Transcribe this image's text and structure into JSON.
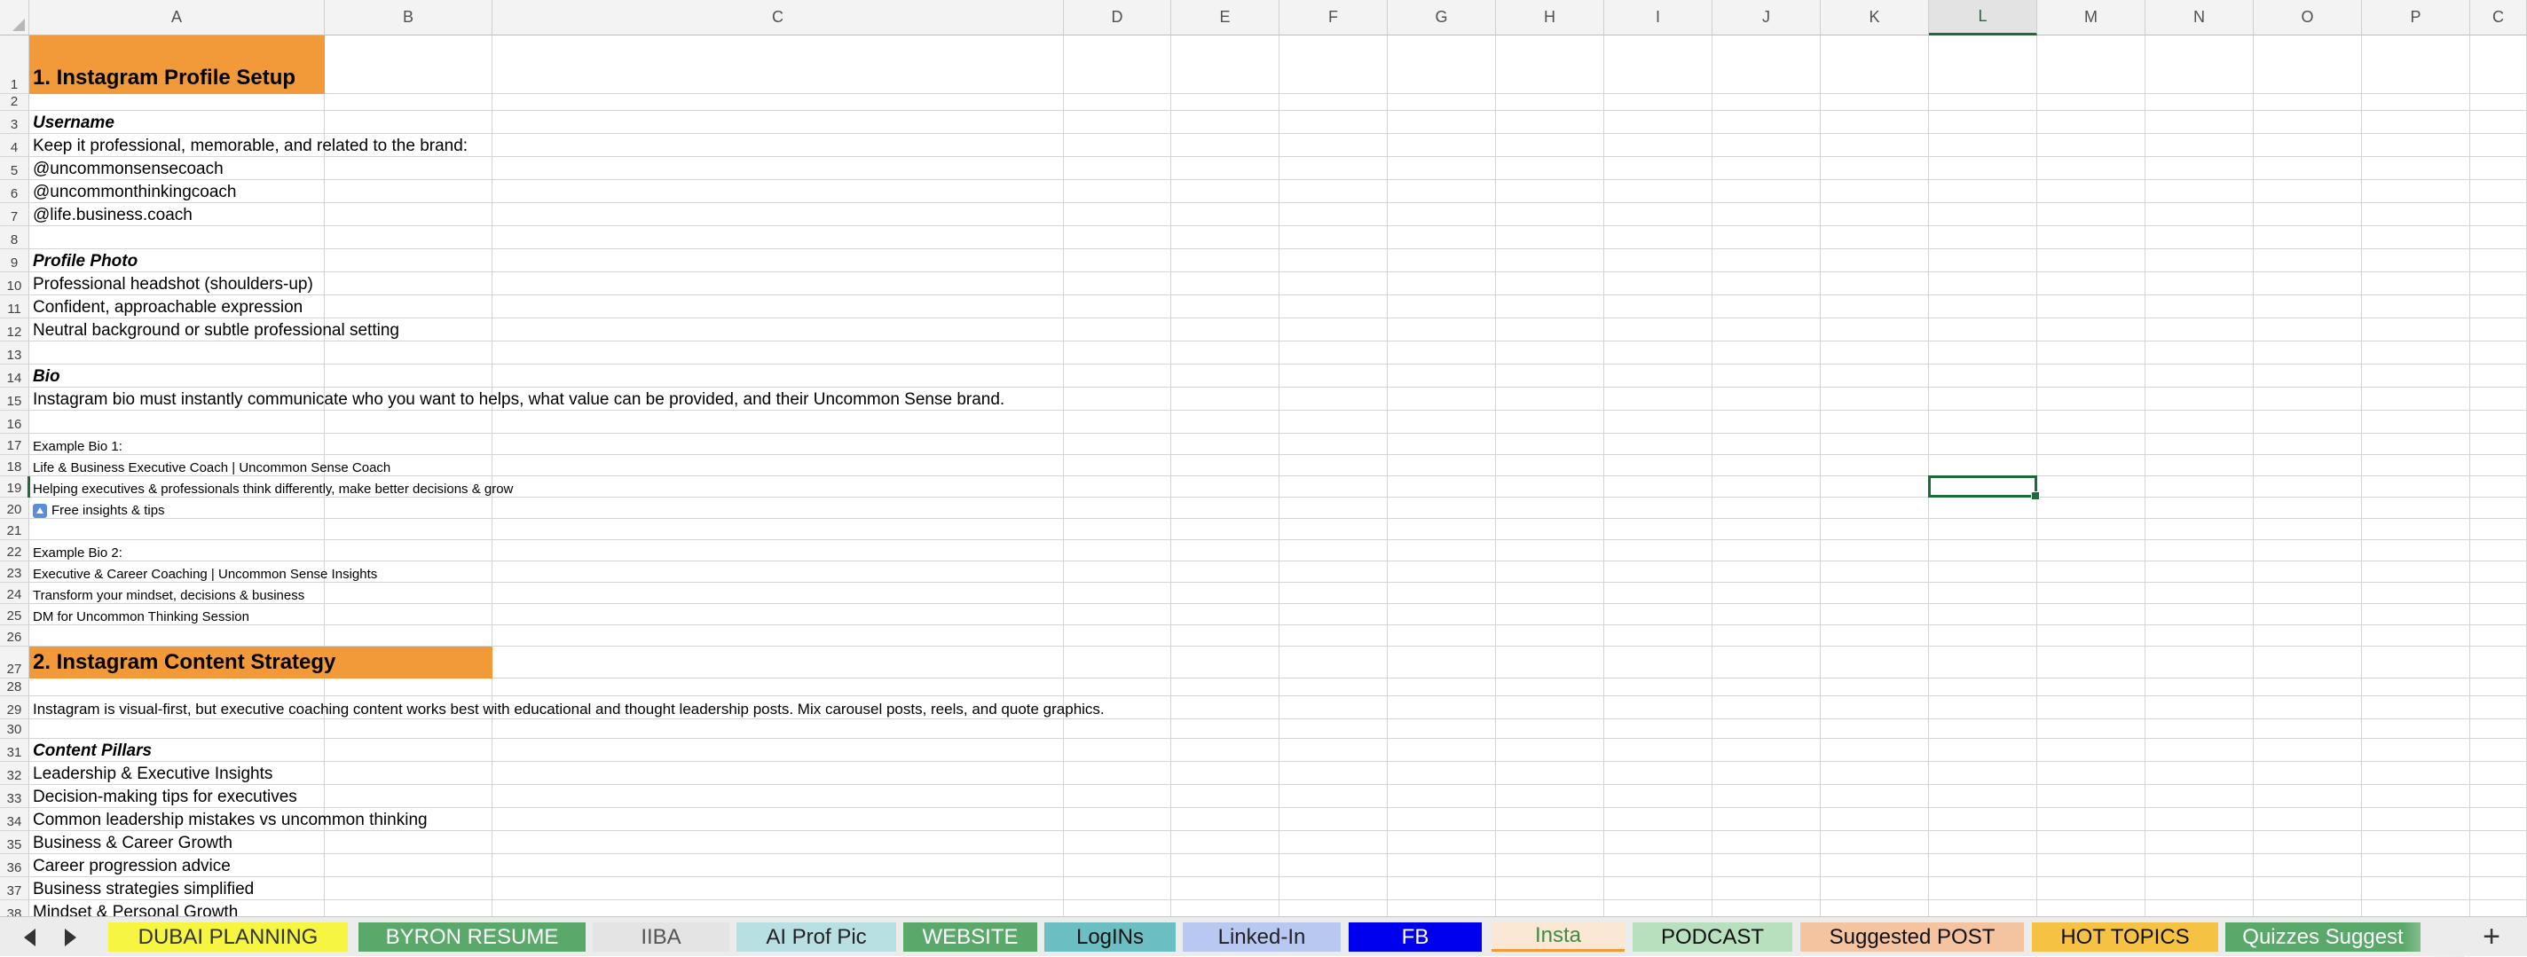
{
  "columns": [
    "A",
    "B",
    "C",
    "D",
    "E",
    "F",
    "G",
    "H",
    "I",
    "J",
    "K",
    "L",
    "M",
    "N",
    "O",
    "P",
    "C"
  ],
  "active_column": "L",
  "active_row": "19",
  "rows": [
    "1",
    "2",
    "3",
    "4",
    "5",
    "6",
    "7",
    "8",
    "9",
    "10",
    "11",
    "12",
    "13",
    "14",
    "15",
    "16",
    "17",
    "18",
    "19",
    "20",
    "21",
    "22",
    "23",
    "24",
    "25",
    "26",
    "27",
    "28",
    "29",
    "30",
    "31",
    "32",
    "33",
    "34",
    "35",
    "36",
    "37",
    "38"
  ],
  "cells": {
    "r1": "1. Instagram Profile Setup",
    "r3": "Username",
    "r4": "Keep it professional, memorable, and related to the brand:",
    "r5": "@uncommonsensecoach",
    "r6": "@uncommonthinkingcoach",
    "r7": "@life.business.coach",
    "r9": "Profile Photo",
    "r10": "Professional headshot (shoulders-up)",
    "r11": "Confident, approachable expression",
    "r12": "Neutral background or subtle professional setting",
    "r14": "Bio",
    "r15": "Instagram bio must instantly communicate who you want to helps, what value can be provided, and their Uncommon Sense brand.",
    "r17": "Example Bio 1:",
    "r18": "Life & Business Executive Coach | Uncommon Sense Coach",
    "r19": "Helping executives & professionals think differently, make better decisions & grow",
    "r20": "Free insights & tips",
    "r22": "Example Bio 2:",
    "r23": "Executive & Career Coaching | Uncommon Sense Insights",
    "r24": "Transform your mindset, decisions & business",
    "r25": "DM for Uncommon Thinking Session",
    "r27": "2. Instagram Content Strategy",
    "r29": "Instagram is visual-first, but executive coaching content works best with educational and thought leadership posts. Mix carousel posts, reels, and quote graphics.",
    "r31": "Content Pillars",
    "r32": "Leadership & Executive Insights",
    "r33": "Decision-making tips for executives",
    "r34": "Common leadership mistakes vs uncommon thinking",
    "r35": "Business & Career Growth",
    "r36": "Career progression advice",
    "r37": "Business strategies simplified",
    "r38": "Mindset & Personal Growth"
  },
  "tabs": [
    {
      "label": "DUBAI PLANNING",
      "bg": "#f5f542",
      "color": "#333333"
    },
    {
      "label": "BYRON RESUME",
      "bg": "#5aa86a",
      "color": "#ffffff"
    },
    {
      "label": "IIBA",
      "bg": "#e4e4e4",
      "color": "#555555"
    },
    {
      "label": "AI Prof Pic",
      "bg": "#b8e0e2",
      "color": "#222222"
    },
    {
      "label": "WEBSITE",
      "bg": "#5aa86a",
      "color": "#ffffff"
    },
    {
      "label": "LogINs",
      "bg": "#6bbec2",
      "color": "#111111"
    },
    {
      "label": "Linked-In",
      "bg": "#b8c8f0",
      "color": "#222222"
    },
    {
      "label": "FB",
      "bg": "#0000ee",
      "color": "#ffffff"
    },
    {
      "label": "Insta",
      "bg": "#fbe8d4",
      "color": "#3e8a48"
    },
    {
      "label": "PODCAST",
      "bg": "#b8e0be",
      "color": "#111111"
    },
    {
      "label": "Suggested POST",
      "bg": "#f4c4a0",
      "color": "#111111"
    },
    {
      "label": "HOT TOPICS",
      "bg": "#f6c244",
      "color": "#111111"
    },
    {
      "label": "Quizzes Suggest",
      "bg": "#5aa86a",
      "color": "#ffffff"
    }
  ],
  "add_tab_label": "+"
}
